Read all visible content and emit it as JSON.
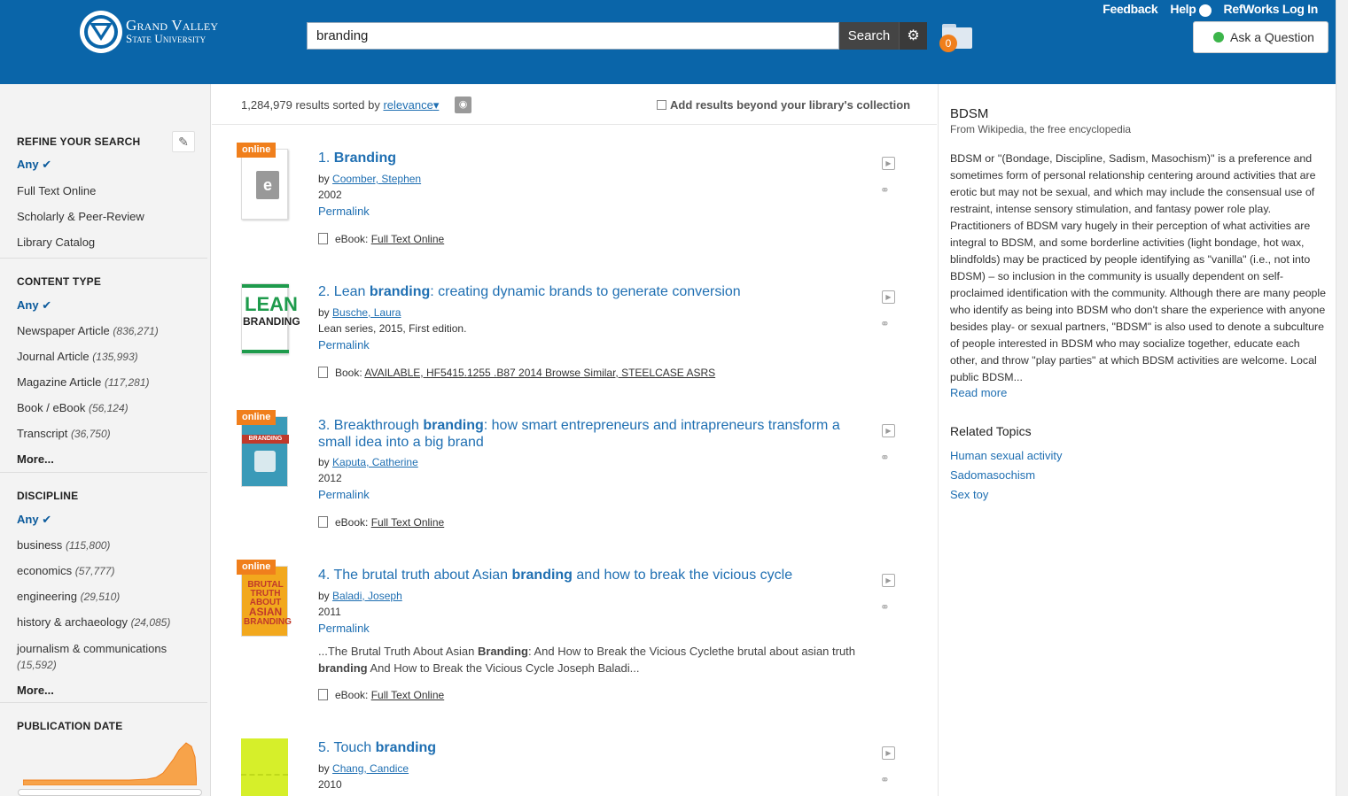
{
  "header": {
    "logo_line1": "Grand Valley",
    "logo_line2": "State University",
    "search_value": "branding",
    "search_button": "Search",
    "folder_count": "0",
    "feedback": "Feedback",
    "help": "Help",
    "refworks": "RefWorks Log In",
    "ask": "Ask a Question"
  },
  "sidebar": {
    "refine_title": "REFINE YOUR SEARCH",
    "refine_any": "Any",
    "refine_items": [
      "Full Text Online",
      "Scholarly & Peer-Review",
      "Library Catalog"
    ],
    "content_title": "CONTENT TYPE",
    "content_any": "Any",
    "content_items": [
      {
        "label": "Newspaper Article",
        "count": "(836,271)"
      },
      {
        "label": "Journal Article",
        "count": "(135,993)"
      },
      {
        "label": "Magazine Article",
        "count": "(117,281)"
      },
      {
        "label": "Book / eBook",
        "count": "(56,124)"
      },
      {
        "label": "Transcript",
        "count": "(36,750)"
      }
    ],
    "content_more": "More...",
    "discipline_title": "DISCIPLINE",
    "discipline_any": "Any",
    "discipline_items": [
      {
        "label": "business",
        "count": "(115,800)"
      },
      {
        "label": "economics",
        "count": "(57,777)"
      },
      {
        "label": "engineering",
        "count": "(29,510)"
      },
      {
        "label": "history & archaeology",
        "count": "(24,085)"
      },
      {
        "label": "journalism & communications",
        "count": "(15,592)"
      }
    ],
    "discipline_more": "More...",
    "pubdate_title": "PUBLICATION DATE"
  },
  "results_bar": {
    "count_text": "1,284,979 results sorted by",
    "sort": "relevance",
    "beyond": "Add results beyond your library's collection"
  },
  "results": [
    {
      "num": "1.",
      "title_pre": "",
      "title_bold": "Branding",
      "title_post": "",
      "by": "by",
      "author": "Coomber, Stephen",
      "line": "2002",
      "perma": "Permalink",
      "format_type": "eBook:",
      "format_link": "Full Text Online",
      "online": "online"
    },
    {
      "num": "2.",
      "title_pre": "Lean ",
      "title_bold": "branding",
      "title_post": ": creating dynamic brands to generate conversion",
      "by": "by",
      "author": "Busche, Laura",
      "line": "Lean series, 2015, First edition.",
      "perma": "Permalink",
      "format_type": "Book:",
      "format_link": "AVAILABLE, HF5415.1255 .B87 2014 Browse Similar, STEELCASE ASRS"
    },
    {
      "num": "3.",
      "title_pre": "Breakthrough ",
      "title_bold": "branding",
      "title_post": ": how smart entrepreneurs and intrapreneurs transform a small idea into a big brand",
      "by": "by",
      "author": "Kaputa, Catherine",
      "line": "2012",
      "perma": "Permalink",
      "format_type": "eBook:",
      "format_link": "Full Text Online",
      "online": "online"
    },
    {
      "num": "4.",
      "title_pre": "The brutal truth about Asian ",
      "title_bold": "branding",
      "title_post": " and how to break the vicious cycle",
      "by": "by",
      "author": "Baladi, Joseph",
      "line": "2011",
      "perma": "Permalink",
      "snippet_1": "...The Brutal Truth About Asian ",
      "snippet_b1": "Branding",
      "snippet_2": ": And How to Break the Vicious Cyclethe brutal about asian truth ",
      "snippet_b2": "branding",
      "snippet_3": " And How to Break the Vicious Cycle Joseph Baladi...",
      "format_type": "eBook:",
      "format_link": "Full Text Online",
      "online": "online"
    },
    {
      "num": "5.",
      "title_pre": "Touch ",
      "title_bold": "branding",
      "title_post": "",
      "by": "by",
      "author": "Chang, Candice",
      "line": "2010"
    }
  ],
  "covers": {
    "lean_1": "LEAN",
    "lean_2": "BRANDING",
    "breakthrough": "BRANDING",
    "brutal_1": "BRUTAL",
    "brutal_2": "TRUTH",
    "brutal_3": "ABOUT",
    "brutal_4": "ASIAN",
    "brutal_5": "BRANDING"
  },
  "rpanel": {
    "title": "BDSM",
    "source": "From Wikipedia, the free encyclopedia",
    "body": "BDSM or ''(Bondage, Discipline, Sadism, Masochism)'' is a preference and sometimes form of personal relationship centering around activities that are erotic but may not be sexual, and which may include the consensual use of restraint, intense sensory stimulation, and fantasy power role play. Practitioners of BDSM vary hugely in their perception of what activities are integral to BDSM, and some borderline activities (light bondage, hot wax, blindfolds) may be practiced by people identifying as \"vanilla\" (i.e., not into BDSM) – so inclusion in the community is usually dependent on self-proclaimed identification with the community. Although there are many people who identify as being into BDSM who don't share the experience with anyone besides play- or sexual partners, \"BDSM\" is also used to denote a subculture of people interested in BDSM who may socialize together, educate each other, and throw \"play parties\" at which BDSM activities are welcome. Local public BDSM...",
    "read_more": "Read more",
    "related_title": "Related Topics",
    "topics": [
      "Human sexual activity",
      "Sadomasochism",
      "Sex toy"
    ]
  },
  "colors": {
    "header_bg": "#0a65a9",
    "link": "#1f6fb2",
    "accent_orange": "#f07f1c",
    "online_dot": "#3cb54a"
  }
}
